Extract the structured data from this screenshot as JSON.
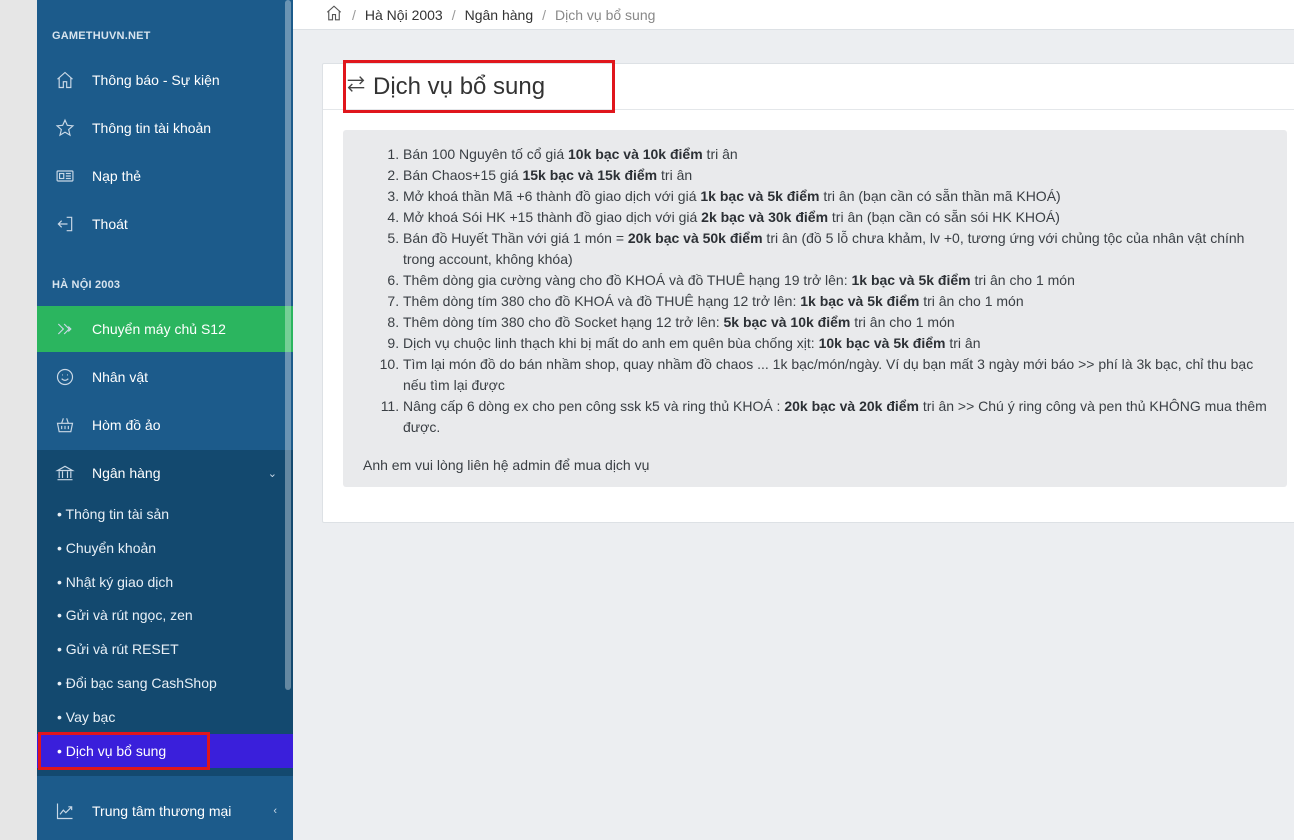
{
  "sidebar": {
    "section1_header": "GAMETHUVN.NET",
    "section2_header": "HÀ NỘI 2003",
    "items": [
      {
        "label": "Thông báo - Sự kiện",
        "icon": "home-icon"
      },
      {
        "label": "Thông tin tài khoản",
        "icon": "star-icon"
      },
      {
        "label": "Nạp thẻ",
        "icon": "card-icon"
      },
      {
        "label": "Thoát",
        "icon": "logout-icon"
      },
      {
        "label": "Chuyển máy chủ S12",
        "icon": "double-chevron-icon"
      },
      {
        "label": "Nhân vật",
        "icon": "smile-icon"
      },
      {
        "label": "Hòm đồ ảo",
        "icon": "basket-icon"
      },
      {
        "label": "Ngân hàng",
        "icon": "bank-icon"
      },
      {
        "label": "Trung tâm thương mại",
        "icon": "chart-icon"
      }
    ],
    "bank_submenu": [
      "• Thông tin tài sản",
      "• Chuyển khoản",
      "• Nhật ký giao dịch",
      "• Gửi và rút ngọc, zen",
      "• Gửi và rút RESET",
      "• Đổi bạc sang CashShop",
      "• Vay bạc",
      "• Dịch vụ bổ sung"
    ]
  },
  "breadcrumb": {
    "items": [
      "Hà Nội 2003",
      "Ngân hàng",
      "Dịch vụ bổ sung"
    ],
    "separator": "/"
  },
  "page": {
    "title": "Dịch vụ bổ sung",
    "services": [
      {
        "pre": "Bán 100 Nguyên tố cổ giá ",
        "bold": "10k bạc và 10k điểm",
        "post": " tri ân"
      },
      {
        "pre": "Bán Chaos+15 giá ",
        "bold": "15k bạc và 15k điểm",
        "post": " tri ân"
      },
      {
        "pre": "Mở khoá thần Mã +6 thành đồ giao dịch với giá ",
        "bold": "1k bạc và 5k điểm",
        "post": " tri ân (bạn cần có sẵn thần mã KHOÁ)"
      },
      {
        "pre": "Mở khoá Sói HK +15 thành đồ giao dịch với giá ",
        "bold": "2k bạc và 30k điểm",
        "post": " tri ân (bạn cần có sẵn sói HK KHOÁ)"
      },
      {
        "pre": "Bán đồ Huyết Thần với giá 1 món = ",
        "bold": "20k bạc và 50k điểm",
        "post": " tri ân (đồ 5 lỗ chưa khảm, lv +0, tương ứng với chủng tộc của nhân vật chính trong account, không khóa)"
      },
      {
        "pre": "Thêm dòng gia cường vàng cho đồ KHOÁ và đồ THUÊ hạng 19 trở lên: ",
        "bold": "1k bạc và 5k điểm",
        "post": " tri ân cho 1 món"
      },
      {
        "pre": "Thêm dòng tím 380 cho đồ KHOÁ và đồ THUÊ hạng 12 trở lên: ",
        "bold": "1k bạc và 5k điểm",
        "post": " tri ân cho 1 món"
      },
      {
        "pre": "Thêm dòng tím 380 cho đồ Socket hạng 12 trở lên: ",
        "bold": "5k bạc và 10k điểm",
        "post": " tri ân cho 1 món"
      },
      {
        "pre": "Dịch vụ chuộc linh thạch khi bị mất do anh em quên bùa chống xịt: ",
        "bold": "10k bạc và 5k điểm",
        "post": " tri ân"
      },
      {
        "pre": "Tìm lại món đồ do bán nhầm shop, quay nhầm đồ chaos ... 1k bạc/món/ngày. Ví dụ bạn mất 3 ngày mới báo >> phí là 3k bạc, chỉ thu bạc nếu tìm lại được",
        "bold": "",
        "post": ""
      },
      {
        "pre": "Nâng cấp 6 dòng ex cho pen công ssk k5 và ring thủ KHOÁ : ",
        "bold": "20k bạc và 20k điểm",
        "post": " tri ân >> Chú ý ring công và pen thủ KHÔNG mua thêm được."
      }
    ],
    "footer_note": "Anh em vui lòng liên hệ admin để mua dịch vụ"
  }
}
